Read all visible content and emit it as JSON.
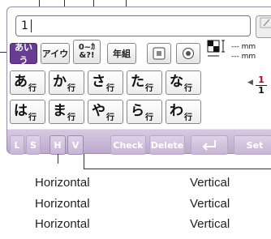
{
  "title_field": {
    "value": "1"
  },
  "edit_icon": "pencil-icon",
  "mode_tabs": [
    {
      "label": "あいう",
      "active": true
    },
    {
      "label": "アイウ",
      "active": false
    },
    {
      "label": "0~ｶ\n&?!",
      "active": false
    },
    {
      "label": "年組",
      "active": false
    }
  ],
  "kana_rows": [
    [
      {
        "char": "あ",
        "gyo": "行"
      },
      {
        "char": "か",
        "gyo": "行"
      },
      {
        "char": "さ",
        "gyo": "行"
      },
      {
        "char": "た",
        "gyo": "行"
      },
      {
        "char": "な",
        "gyo": "行"
      }
    ],
    [
      {
        "char": "は",
        "gyo": "行"
      },
      {
        "char": "ま",
        "gyo": "行"
      },
      {
        "char": "や",
        "gyo": "行"
      },
      {
        "char": "ら",
        "gyo": "行"
      },
      {
        "char": "わ",
        "gyo": "行"
      }
    ]
  ],
  "size": {
    "unit_1": "mm",
    "unit_2": "mm",
    "numerator": "1",
    "denominator": "1"
  },
  "bottom_bar": {
    "l": "L",
    "s": "S",
    "h": "H",
    "v": "V",
    "check": "Check",
    "delete": "Delete",
    "enter_icon": "enter-arrow-icon",
    "set": "Set"
  },
  "callouts": {
    "horizontal": [
      "Horizontal",
      "Horizontal",
      "Horizontal"
    ],
    "vertical": [
      "Vertical",
      "Vertical",
      "Vertical"
    ]
  },
  "colors": {
    "active_tab": "#6a3b93",
    "fraction_numerator": "#c0001f",
    "panel_gradient": "#bca6cc"
  }
}
